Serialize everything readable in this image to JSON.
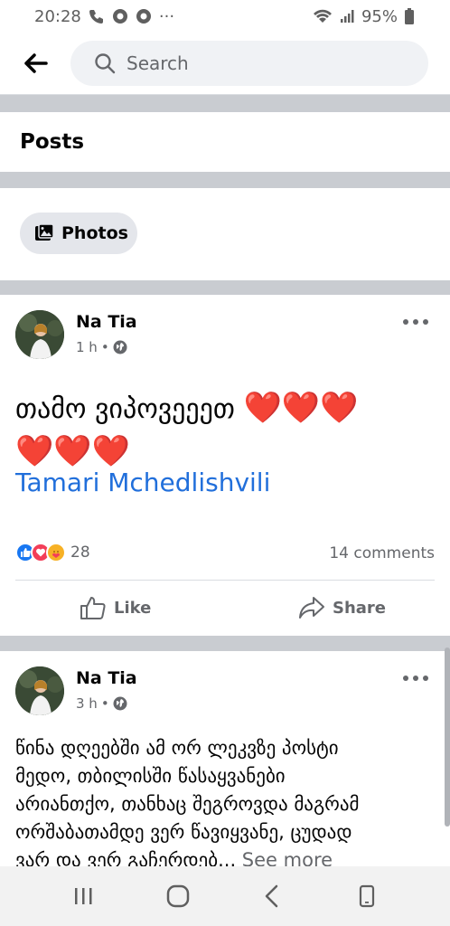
{
  "status_bar": {
    "time": "20:28",
    "dots": "···",
    "battery": "95%"
  },
  "search": {
    "placeholder": "Search"
  },
  "sections": {
    "posts_title": "Posts",
    "photos_label": "Photos"
  },
  "posts": [
    {
      "author": "Na Tia",
      "time": "1 h",
      "separator": "•",
      "text_line1": "თამო ვიპოვეეეთ",
      "hearts_line1": "❤️❤️❤️",
      "hearts_line2": "❤️❤️❤️",
      "mention": "Tamari Mchedlishvili",
      "reaction_count": "28",
      "comments": "14 comments",
      "like_label": "Like",
      "share_label": "Share"
    },
    {
      "author": "Na Tia",
      "time": "3 h",
      "separator": "•",
      "text_lines": [
        "წინა დღეებში ამ ორ ლეკვზე პოსტი",
        "მედო, თბილისში წასაყვანები",
        "არიანთქო, თანხაც შეგროვდა მაგრამ",
        "ორშაბათამდე ვერ წავიყვანე, ცუდად",
        "ვარ და ვერ გაჩერდებ"
      ],
      "see_more": "See more"
    }
  ],
  "colors": {
    "accent": "#216fdb",
    "heart": "#e0202d",
    "separator": "#c9ccd1"
  }
}
